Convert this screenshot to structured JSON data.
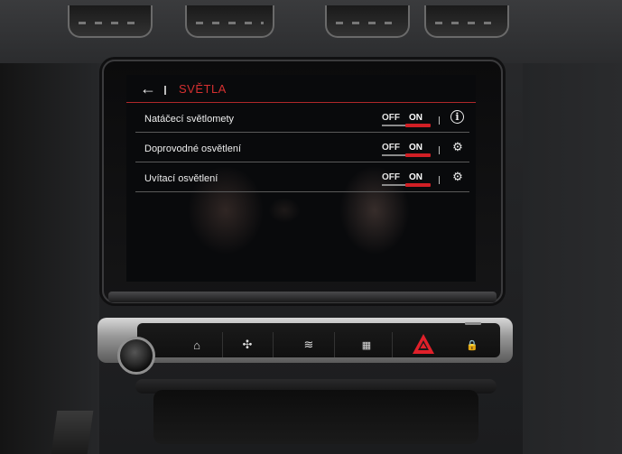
{
  "screen": {
    "title": "SVĚTLA",
    "back_icon": "back-arrow-icon",
    "accent_color": "#d63030",
    "rows": [
      {
        "label": "Natáčecí světlomety",
        "off": "OFF",
        "on": "ON",
        "state": "on",
        "icon": "info-icon",
        "icon_glyph": "i"
      },
      {
        "label": "Doprovodné osvětlení",
        "off": "OFF",
        "on": "ON",
        "state": "on",
        "icon": "gear-icon",
        "icon_glyph": "⚙"
      },
      {
        "label": "Uvítací osvětlení",
        "off": "OFF",
        "on": "ON",
        "state": "on",
        "icon": "gear-icon",
        "icon_glyph": "⚙"
      }
    ]
  },
  "console_buttons": [
    {
      "name": "home-icon",
      "glyph": "⌂"
    },
    {
      "name": "fan-settings-icon",
      "glyph": "✣"
    },
    {
      "name": "front-defrost-icon",
      "glyph": "≋"
    },
    {
      "name": "rear-defrost-icon",
      "glyph": "▦"
    },
    {
      "name": "hazard-icon",
      "glyph": "▲"
    },
    {
      "name": "door-lock-icon",
      "glyph": "🔒"
    }
  ]
}
